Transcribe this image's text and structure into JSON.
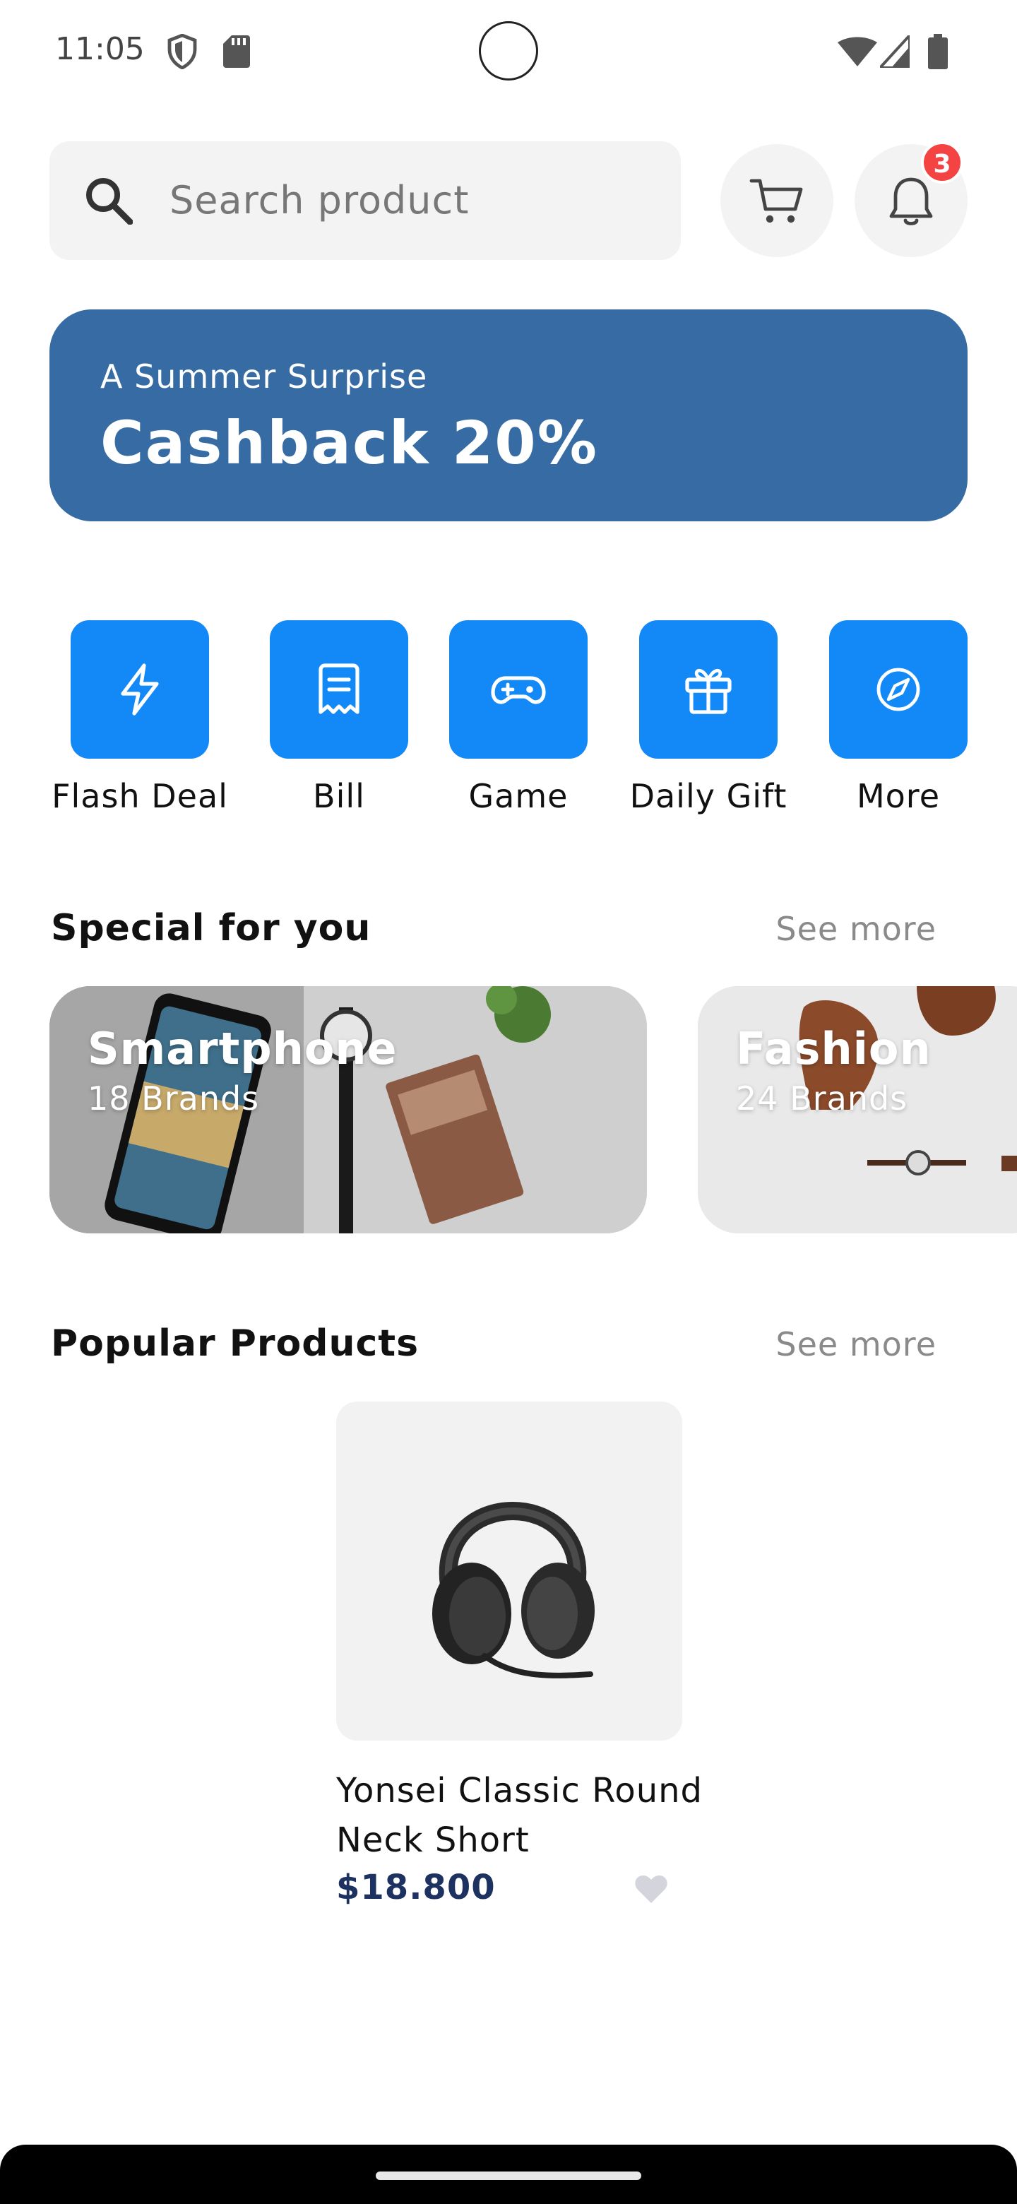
{
  "status_bar": {
    "time": "11:05"
  },
  "search": {
    "placeholder": "Search product"
  },
  "notifications": {
    "badge_count": "3"
  },
  "banner": {
    "subtitle": "A Summer Surprise",
    "title": "Cashback 20%"
  },
  "categories": [
    {
      "label": "Flash Deal",
      "icon": "lightning-icon"
    },
    {
      "label": "Bill",
      "icon": "receipt-icon"
    },
    {
      "label": "Game",
      "icon": "gamepad-icon"
    },
    {
      "label": "Daily Gift",
      "icon": "gift-icon"
    },
    {
      "label": "More",
      "icon": "compass-icon"
    }
  ],
  "special": {
    "title": "Special for you",
    "see_more": "See more",
    "cards": [
      {
        "title": "Smartphone",
        "subtitle": "18 Brands"
      },
      {
        "title": "Fashion",
        "subtitle": "24 Brands"
      }
    ]
  },
  "popular": {
    "title": "Popular Products",
    "see_more": "See more",
    "products": [
      {
        "name": "Yonsei Classic Round Neck Short",
        "price": "$18.800"
      }
    ]
  },
  "colors": {
    "accent": "#1289f7",
    "banner": "#366ba3",
    "badge": "#f44343",
    "price": "#1d3260"
  }
}
